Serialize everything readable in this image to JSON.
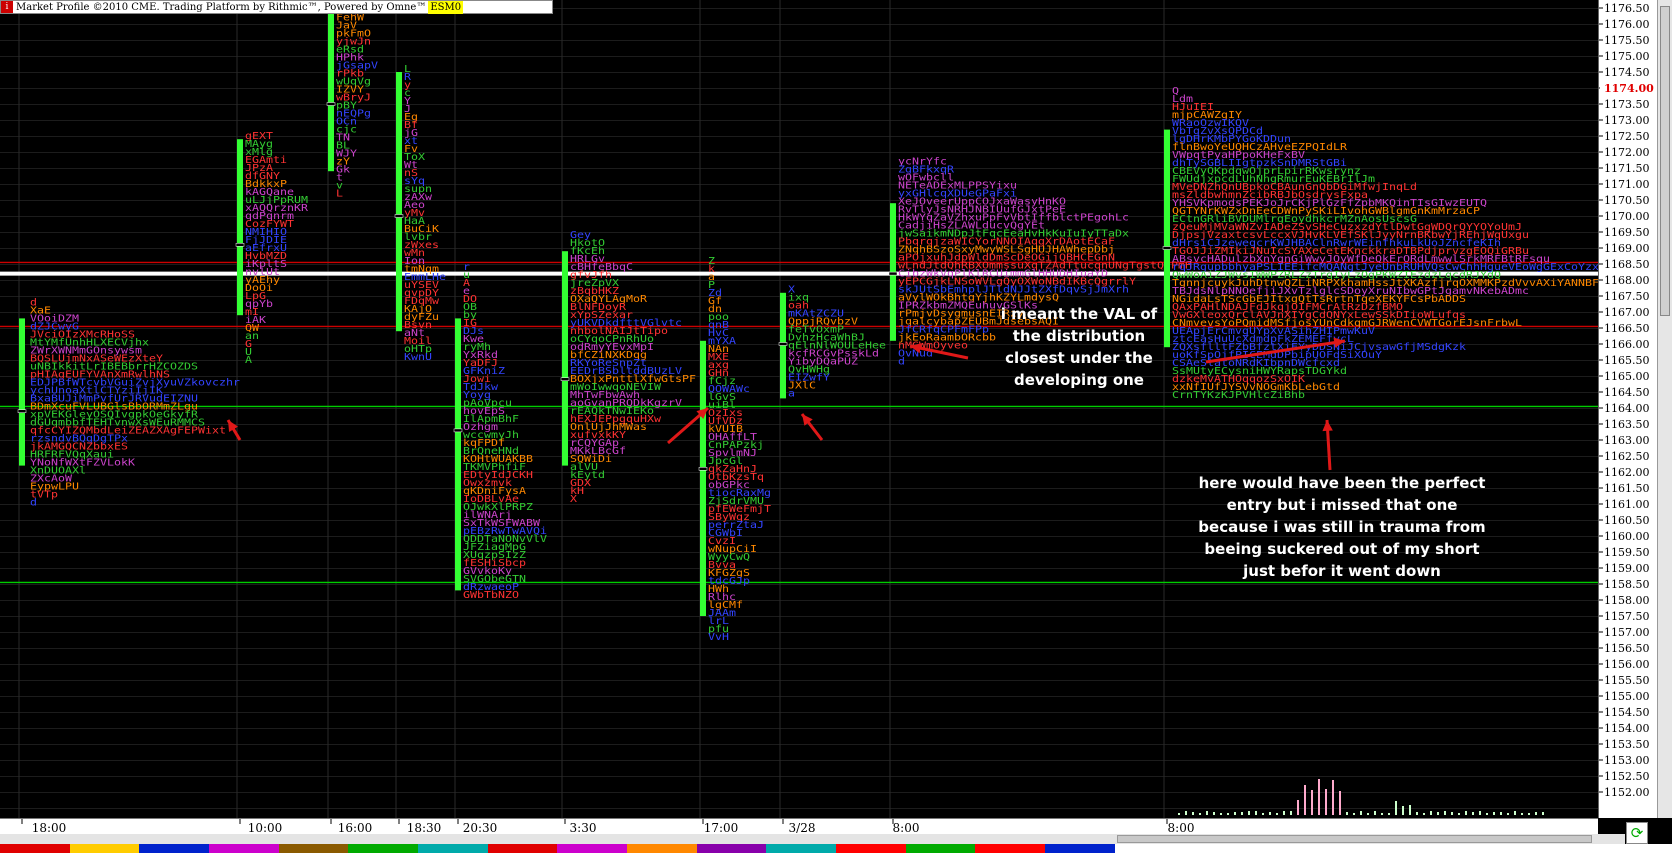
{
  "window": {
    "title": "Market Profile ©2010 CME. Trading Platform by Rithmic™, Powered by Omne™",
    "symbol": "ESM0"
  },
  "chart_data": {
    "type": "market-profile",
    "y_range": [
      1151.5,
      1176.5
    ],
    "price_ticks": [
      "1176.50",
      "1176.00",
      "1175.50",
      "1175.00",
      "1174.50",
      "1174.00",
      "1173.50",
      "1173.00",
      "1172.50",
      "1172.00",
      "1171.50",
      "1171.00",
      "1170.50",
      "1170.00",
      "1169.50",
      "1169.00",
      "1168.50",
      "1168.00",
      "1167.50",
      "1167.00",
      "1166.50",
      "1166.00",
      "1165.50",
      "1165.00",
      "1164.50",
      "1164.00",
      "1163.50",
      "1163.00",
      "1162.50",
      "1162.00",
      "1161.50",
      "1161.00",
      "1160.50",
      "1160.00",
      "1159.50",
      "1159.00",
      "1158.50",
      "1158.00",
      "1157.50",
      "1157.00",
      "1156.50",
      "1156.00",
      "1155.50",
      "1155.00",
      "1154.50",
      "1154.00",
      "1153.50",
      "1153.00",
      "1152.50",
      "1152.00"
    ],
    "current_price": "1174.00",
    "time_labels": [
      "18:00",
      "10:00",
      "16:00",
      "18:30",
      "20:30",
      "3:30",
      "17:00",
      "3/28",
      "8:00",
      "8:00"
    ],
    "horizontal_lines": [
      {
        "price": 1168.55,
        "color": "#cc0000"
      },
      {
        "price": 1168.2,
        "color": "#ffffff"
      },
      {
        "price": 1166.55,
        "color": "#cc0000"
      },
      {
        "price": 1164.05,
        "color": "#00cc00"
      },
      {
        "price": 1158.55,
        "color": "#00cc00"
      }
    ],
    "value_area_bars": [
      {
        "session": 0,
        "low": 1162.2,
        "high": 1166.8,
        "poc": 1163.9
      },
      {
        "session": 1,
        "low": 1166.9,
        "high": 1172.4,
        "poc": 1169.1
      },
      {
        "session": 2,
        "low": 1171.4,
        "high": 1176.5,
        "poc": 1173.5
      },
      {
        "session": 3,
        "low": 1166.4,
        "high": 1174.5,
        "poc": 1170.0
      },
      {
        "session": 4,
        "low": 1158.3,
        "high": 1166.8,
        "poc": 1163.3
      },
      {
        "session": 5,
        "low": 1162.2,
        "high": 1168.9,
        "poc": 1164.9
      },
      {
        "session": 6,
        "low": 1157.5,
        "high": 1166.1,
        "poc": 1162.1
      },
      {
        "session": 7,
        "low": 1164.3,
        "high": 1167.6,
        "poc": 1166.0
      },
      {
        "session": 8,
        "low": 1166.1,
        "high": 1170.4,
        "poc": 1168.2
      },
      {
        "session": 9,
        "low": 1165.9,
        "high": 1172.7,
        "poc": 1169.0
      }
    ],
    "volume_bars": "small columns along the bottom of the last two sessions",
    "colors": {
      "va_bar": "#33ff33",
      "tpo_red": "#ff3333",
      "tpo_green": "#33cc33",
      "tpo_blue": "#3344ff",
      "tpo_purple": "#cc44cc",
      "tpo_orange": "#ff8800",
      "grid": "#1c1c1c"
    }
  },
  "annotations": {
    "note1": "i meant the VAL of\nthe distribution\nclosest  under the\ndeveloping one",
    "note2": "here would have been the perfect\nentry but i missed that one\nbecause i was still in trauma from\nbeeing suckered out of my short\njust befor it went down"
  }
}
